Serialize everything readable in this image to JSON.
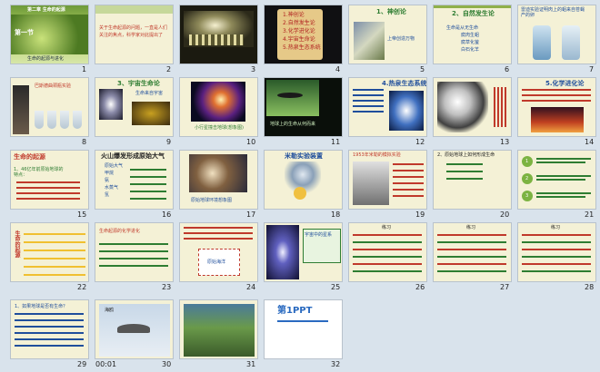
{
  "slides": [
    {
      "n": "1",
      "title": "第二章 生命的起源",
      "line1": "生命的起源与进化",
      "line2": "第一节"
    },
    {
      "n": "2",
      "line1": "关于生命起源的问题，一直是人们",
      "line2": "关注的焦点，科学家对此提出了"
    },
    {
      "n": "3"
    },
    {
      "n": "4",
      "items": [
        "1.神创论",
        "2.自然发生论",
        "3.化学进化论",
        "4.宇宙生命论",
        "5.热泉生态系统"
      ]
    },
    {
      "n": "5",
      "title": "1、神创论",
      "label": "上帝创造万物"
    },
    {
      "n": "6",
      "title": "2、自然发生论",
      "items": [
        "生命是从无生命",
        "腐肉生蛆",
        "腐草化萤",
        "白石化羊"
      ]
    },
    {
      "n": "7",
      "line1": "雷迪实验证明肉上的蛆来自苍蝇",
      "line2": "产的卵"
    },
    {
      "n": "8",
      "line1": "巴斯德曲颈瓶实验"
    },
    {
      "n": "9",
      "title": "3、宇宙生命论",
      "line1": "生命来自宇宙"
    },
    {
      "n": "10",
      "caption": "小行星撞击地球(想象图)"
    },
    {
      "n": "11",
      "caption": "地球上的生命从何而来"
    },
    {
      "n": "12",
      "title": "4.热泉生态系统"
    },
    {
      "n": "13"
    },
    {
      "n": "14",
      "title": "5.化学进化论"
    },
    {
      "n": "15",
      "title": "生命的起源",
      "line1": "1、46亿年前原始地球的",
      "line2": "特点："
    },
    {
      "n": "16",
      "title": "火山爆发形成原始大气",
      "rows": [
        "原始大气",
        "甲烷",
        "氨",
        "水蒸气",
        "氢"
      ]
    },
    {
      "n": "17",
      "caption": "原始地球环境想象图"
    },
    {
      "n": "18",
      "title": "米勒实验装置"
    },
    {
      "n": "19",
      "line1": "1953年米勒的模拟实验"
    },
    {
      "n": "20",
      "line1": "2、原始地球上如何形成生命"
    },
    {
      "n": "21",
      "items": [
        "1",
        "2",
        "3"
      ]
    },
    {
      "n": "22",
      "title": "生命的起源"
    },
    {
      "n": "23",
      "title": "生命起源的化学进化"
    },
    {
      "n": "24",
      "line1": "原始海洋"
    },
    {
      "n": "25",
      "line1": "宇宙中的星系"
    },
    {
      "n": "26",
      "line1": "练习"
    },
    {
      "n": "27",
      "line1": "练习"
    },
    {
      "n": "28",
      "line1": "练习"
    },
    {
      "n": "29",
      "line1": "1、如果地球是否有生命？"
    },
    {
      "n": "30",
      "time": "00:01",
      "label": "海鸥"
    },
    {
      "n": "31"
    },
    {
      "n": "32",
      "logo": "第1PPT"
    }
  ],
  "colors": {
    "background": "#d9e3ec",
    "selection": "#3a6fb0"
  }
}
